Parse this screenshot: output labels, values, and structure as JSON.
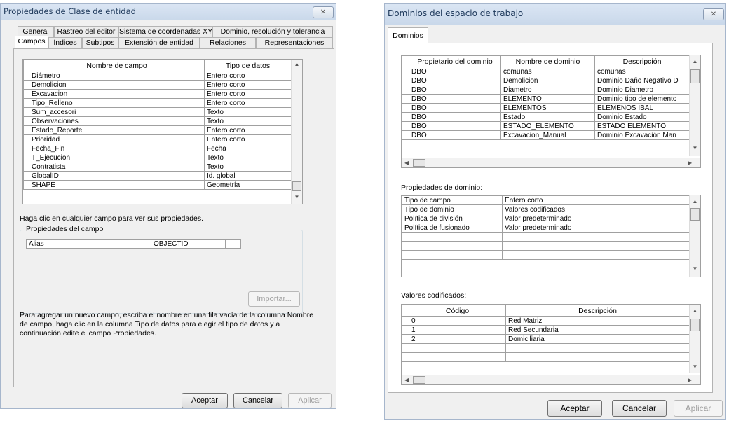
{
  "left_dialog": {
    "title": "Propiedades de Clase de entidad",
    "tabs_back": [
      "General",
      "Rastreo del editor",
      "Sistema de coordenadas XY",
      "Dominio, resolución y tolerancia"
    ],
    "tabs_front": [
      "Campos",
      "Índices",
      "Subtipos",
      "Extensión de entidad",
      "Relaciones",
      "Representaciones"
    ],
    "fields_table": {
      "headers": [
        "Nombre de campo",
        "Tipo de datos"
      ],
      "rows": [
        [
          "Diámetro",
          "Entero corto"
        ],
        [
          "Demolicion",
          "Entero corto"
        ],
        [
          "Excavacion",
          "Entero corto"
        ],
        [
          "Tipo_Relleno",
          "Entero corto"
        ],
        [
          "Sum_accesori",
          "Texto"
        ],
        [
          "Observaciones",
          "Texto"
        ],
        [
          "Estado_Reporte",
          "Entero corto"
        ],
        [
          "Prioridad",
          "Entero corto"
        ],
        [
          "Fecha_Fin",
          "Fecha"
        ],
        [
          "T_Ejecucion",
          "Texto"
        ],
        [
          "Contratista",
          "Texto"
        ],
        [
          "GlobalID",
          "Id. global"
        ],
        [
          "SHAPE",
          "Geometría"
        ]
      ]
    },
    "hint": "Haga clic en cualquier campo para ver sus propiedades.",
    "field_props_title": "Propiedades del campo",
    "field_props": [
      [
        "Alias",
        "OBJECTID"
      ]
    ],
    "import_button": "Importar...",
    "instructions": [
      "Para agregar un nuevo campo, escriba el nombre en una fila vacía de la columna Nombre",
      "de campo, haga clic en la columna Tipo de datos para elegir el tipo de datos y a",
      "continuación edite el campo Propiedades."
    ],
    "buttons": {
      "ok": "Aceptar",
      "cancel": "Cancelar",
      "apply": "Aplicar"
    }
  },
  "right_dialog": {
    "title": "Dominios del espacio de trabajo",
    "tab": "Dominios",
    "domains_table": {
      "headers": [
        "Propietario del dominio",
        "Nombre de dominio",
        "Descripción"
      ],
      "rows": [
        [
          "DBO",
          "comunas",
          "comunas"
        ],
        [
          "DBO",
          "Demolicion",
          "Dominio Daño Negativo D"
        ],
        [
          "DBO",
          "Diametro",
          "Dominio Diametro"
        ],
        [
          "DBO",
          "ELEMENTO",
          "Dominio tipo de elemento"
        ],
        [
          "DBO",
          "ELEMENTOS",
          "ELEMENOS IBAL"
        ],
        [
          "DBO",
          "Estado",
          "Dominio Estado"
        ],
        [
          "DBO",
          "ESTADO_ELEMENTO",
          "ESTADO ELEMENTO"
        ],
        [
          "DBO",
          "Excavacion_Manual",
          "Dominio Excavación Man"
        ]
      ]
    },
    "domain_props_label": "Propiedades de dominio:",
    "domain_props": [
      [
        "Tipo de campo",
        "Entero corto"
      ],
      [
        "Tipo de dominio",
        "Valores codificados"
      ],
      [
        "Política de división",
        "Valor predeterminado"
      ],
      [
        "Política de fusionado",
        "Valor predeterminado"
      ],
      [
        "",
        ""
      ],
      [
        "",
        ""
      ],
      [
        "",
        ""
      ]
    ],
    "coded_values_label": "Valores codificados:",
    "coded_values": {
      "headers": [
        "Código",
        "Descripción"
      ],
      "rows": [
        [
          "0",
          "Red Matriz"
        ],
        [
          "1",
          "Red Secundaria"
        ],
        [
          "2",
          "Domiciliaria"
        ],
        [
          "",
          ""
        ],
        [
          "",
          ""
        ]
      ]
    },
    "buttons": {
      "ok": "Aceptar",
      "cancel": "Cancelar",
      "apply": "Aplicar"
    }
  }
}
